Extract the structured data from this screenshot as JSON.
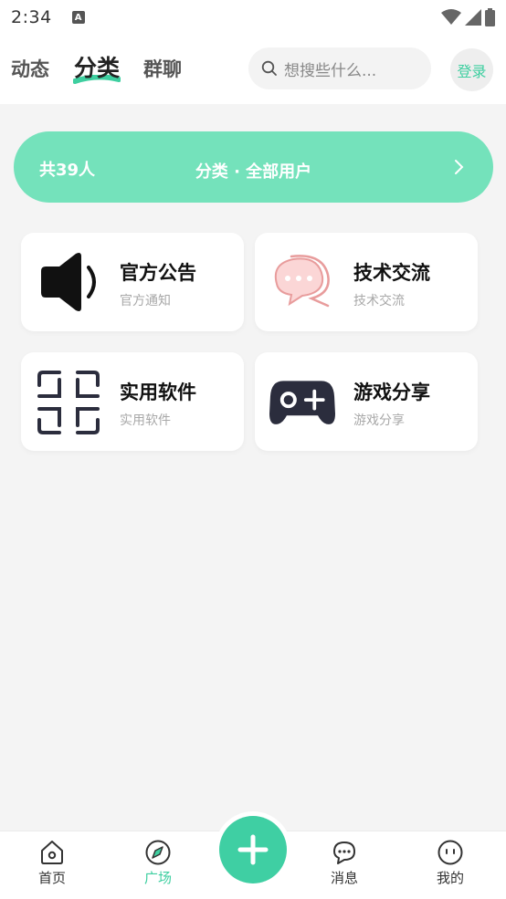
{
  "status_bar": {
    "time": "2:34",
    "notification_icon": "A"
  },
  "header": {
    "tabs": [
      {
        "label": "动态",
        "active": false
      },
      {
        "label": "分类",
        "active": true
      },
      {
        "label": "群聊",
        "active": false
      }
    ],
    "search": {
      "placeholder": "想搜些什么..."
    },
    "login_label": "登录"
  },
  "banner": {
    "count": "共39人",
    "title": "分类 · 全部用户"
  },
  "categories": [
    {
      "title": "官方公告",
      "subtitle": "官方通知",
      "icon": "megaphone-icon"
    },
    {
      "title": "技术交流",
      "subtitle": "技术交流",
      "icon": "chat-bubbles-icon"
    },
    {
      "title": "实用软件",
      "subtitle": "实用软件",
      "icon": "scan-frame-icon"
    },
    {
      "title": "游戏分享",
      "subtitle": "游戏分享",
      "icon": "gamepad-icon"
    }
  ],
  "bottom_nav": {
    "items": [
      {
        "label": "首页",
        "active": false
      },
      {
        "label": "广场",
        "active": true
      },
      {
        "label": "消息",
        "active": false
      },
      {
        "label": "我的",
        "active": false
      }
    ]
  },
  "colors": {
    "accent": "#3ecfa0",
    "banner": "#74e2bb",
    "background": "#f4f4f4"
  }
}
